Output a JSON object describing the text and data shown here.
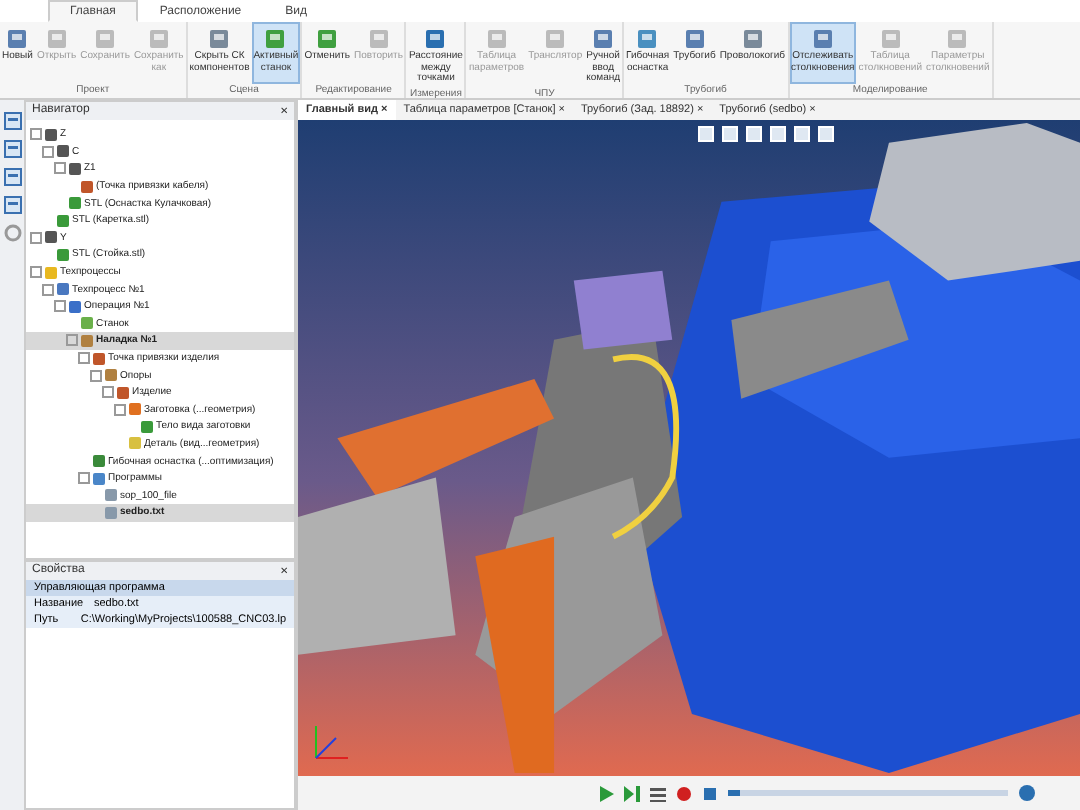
{
  "ribbon_tabs": [
    {
      "label": "Главная",
      "selected": true
    },
    {
      "label": "Расположение",
      "selected": false
    },
    {
      "label": "Вид",
      "selected": false
    }
  ],
  "ribbon_groups": [
    {
      "title": "Проект",
      "buttons": [
        {
          "label": "Новый",
          "selected": false,
          "disabled": false
        },
        {
          "label": "Открыть",
          "selected": false,
          "disabled": true
        },
        {
          "label": "Сохранить",
          "selected": false,
          "disabled": true
        },
        {
          "label": "Сохранить как",
          "selected": false,
          "disabled": true
        }
      ]
    },
    {
      "title": "Сцена",
      "buttons": [
        {
          "label": "Скрыть СК компонентов",
          "selected": false,
          "disabled": false
        },
        {
          "label": "Активный станок",
          "selected": true,
          "disabled": false
        }
      ]
    },
    {
      "title": "Редактирование",
      "buttons": [
        {
          "label": "Отменить",
          "selected": false,
          "disabled": false
        },
        {
          "label": "Повторить",
          "selected": false,
          "disabled": true
        }
      ]
    },
    {
      "title": "Измерения",
      "buttons": [
        {
          "label": "Расстояние между точками",
          "selected": false,
          "disabled": false
        }
      ]
    },
    {
      "title": "ЧПУ",
      "buttons": [
        {
          "label": "Таблица параметров",
          "selected": false,
          "disabled": true
        },
        {
          "label": "Транслятор",
          "selected": false,
          "disabled": true
        },
        {
          "label": "Ручной ввод команд",
          "selected": false,
          "disabled": false
        }
      ]
    },
    {
      "title": "Трубогиб",
      "buttons": [
        {
          "label": "Гибочная оснастка",
          "selected": false,
          "disabled": false
        },
        {
          "label": "Трубогиб",
          "selected": false,
          "disabled": false
        },
        {
          "label": "Проволокогиб",
          "selected": false,
          "disabled": false
        }
      ]
    },
    {
      "title": "Моделирование",
      "buttons": [
        {
          "label": "Отслеживать столкновения",
          "selected": true,
          "disabled": false
        },
        {
          "label": "Таблица столкновений",
          "selected": false,
          "disabled": true
        },
        {
          "label": "Параметры столкновений",
          "selected": false,
          "disabled": true
        }
      ]
    }
  ],
  "navigator": {
    "title": "Навигатор",
    "close": "✕",
    "tree": [
      {
        "label": "Z",
        "kind": "axis",
        "selected": false,
        "children": [
          {
            "label": "C",
            "kind": "axis",
            "selected": false,
            "children": [
              {
                "label": "Z1",
                "kind": "axis",
                "selected": false,
                "children": [
                  {
                    "label": "(Точка привязки кабеля)",
                    "kind": "point",
                    "selected": false
                  }
                ]
              },
              {
                "label": "STL (Оснастка Кулачковая)",
                "kind": "stl",
                "selected": false
              }
            ]
          },
          {
            "label": "STL (Каретка.stl)",
            "kind": "stl",
            "selected": false
          }
        ]
      },
      {
        "label": "Y",
        "kind": "axis",
        "selected": false,
        "children": [
          {
            "label": "STL (Стойка.stl)",
            "kind": "stl",
            "selected": false
          }
        ]
      },
      {
        "label": "Техпроцессы",
        "kind": "folder",
        "selected": false,
        "children": [
          {
            "label": "Техпроцесс №1",
            "kind": "process",
            "selected": false,
            "children": [
              {
                "label": "Операция №1",
                "kind": "operation",
                "selected": false,
                "children": [
                  {
                    "label": "Станок",
                    "kind": "machine",
                    "selected": false
                  },
                  {
                    "label": "Наладка №1",
                    "kind": "setup",
                    "selected": true,
                    "children": [
                      {
                        "label": "Точка привязки изделия",
                        "kind": "point",
                        "selected": false,
                        "children": [
                          {
                            "label": "Опоры",
                            "kind": "setup",
                            "selected": false,
                            "children": [
                              {
                                "label": "Изделие",
                                "kind": "point",
                                "selected": false,
                                "children": [
                                  {
                                    "label": "Заготовка (...геометрия)",
                                    "kind": "part",
                                    "selected": false,
                                    "children": [
                                      {
                                        "label": "Тело вида заготовки",
                                        "kind": "stl",
                                        "selected": false
                                      }
                                    ]
                                  },
                                  {
                                    "label": "Деталь (вид...геометрия)",
                                    "kind": "detail",
                                    "selected": false
                                  }
                                ]
                              }
                            ]
                          }
                        ]
                      },
                      {
                        "label": "Гибочная оснастка (...оптимизация)",
                        "kind": "tooling",
                        "selected": false
                      },
                      {
                        "label": "Программы",
                        "kind": "folder2",
                        "selected": false,
                        "children": [
                          {
                            "label": "sop_100_file",
                            "kind": "file",
                            "selected": false
                          },
                          {
                            "label": "sedbo.txt",
                            "kind": "file",
                            "selected": true
                          }
                        ]
                      }
                    ]
                  }
                ]
              }
            ]
          }
        ]
      }
    ]
  },
  "properties": {
    "title": "Свойства",
    "close": "✕",
    "group": "Управляющая программа",
    "rows": [
      {
        "name": "Название",
        "value": "sedbo.txt"
      },
      {
        "name": "Путь",
        "value": "C:\\Working\\MyProjects\\100588_CNC03.lp"
      }
    ]
  },
  "view_tabs": [
    {
      "label": "Главный вид",
      "close": "×",
      "selected": true
    },
    {
      "label": "Таблица параметров [Станок]",
      "close": "×",
      "selected": false
    },
    {
      "label": "Трубогиб (Зад. 18892)",
      "close": "×",
      "selected": false
    },
    {
      "label": "Трубогиб (sedbo)",
      "close": "×",
      "selected": false
    }
  ],
  "playback": {
    "level": 0.04
  }
}
